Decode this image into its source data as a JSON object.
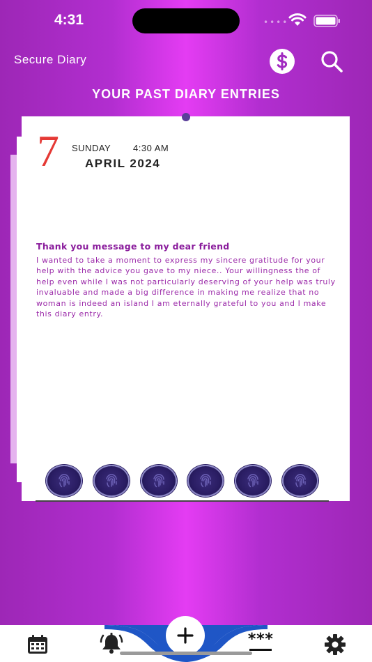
{
  "status_bar": {
    "time": "4:31",
    "signal_dots": "••••"
  },
  "header": {
    "title": "Secure Diary",
    "dollar_icon": "dollar-circle-icon",
    "search_icon": "search-icon"
  },
  "section": {
    "title": "YOUR PAST DIARY ENTRIES"
  },
  "entry": {
    "day": "7",
    "weekday": "SUNDAY",
    "time": "4:30 AM",
    "month_year": "APRIL  2024",
    "title": "Thank you message to my dear friend",
    "body": "I wanted to take a moment to express my sincere gratitude for your help with the advice you gave to my niece.. Your willingness the of help even while I was not particularly deserving of your help was truly invaluable and made a big difference in making me realize that no woman is indeed an island I am eternally grateful to you and I make this diary entry."
  },
  "fingerprint_count": 6,
  "tab_bar": {
    "items": [
      "calendar-icon",
      "alarm-bell-icon",
      "plus-icon",
      "password-icon",
      "gear-icon"
    ],
    "password_label": "***"
  },
  "colors": {
    "accent": "#e43cf3",
    "purple": "#9b2aa9",
    "day_red": "#e53935",
    "wave_blue": "#1f56c6"
  }
}
